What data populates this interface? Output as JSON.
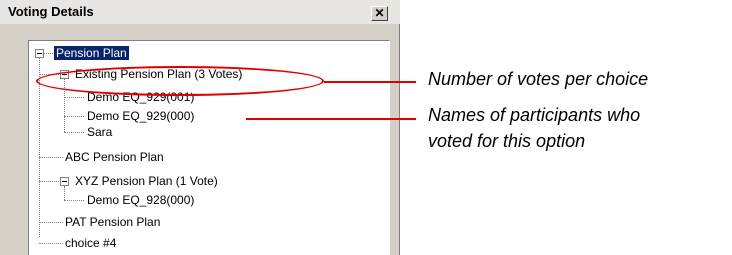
{
  "window": {
    "title": "Voting Details",
    "close_glyph": "✕"
  },
  "tree": {
    "root": "Pension Plan",
    "existing": "Existing Pension Plan (3 Votes)",
    "existing_voters": [
      "Demo EQ_929(001)",
      "Demo EQ_929(000)",
      "Sara"
    ],
    "abc": "ABC Pension Plan",
    "xyz": "XYZ Pension Plan (1 Vote)",
    "xyz_voters": [
      "Demo EQ_928(000)"
    ],
    "pat": "PAT Pension Plan",
    "choice4": "choice #4"
  },
  "annotations": {
    "votes_per_choice": "Number of votes per choice",
    "participants_line1": "Names of participants who",
    "participants_line2": "voted for this option"
  },
  "colors": {
    "accent": "#e00000",
    "selection": "#0a246a"
  }
}
